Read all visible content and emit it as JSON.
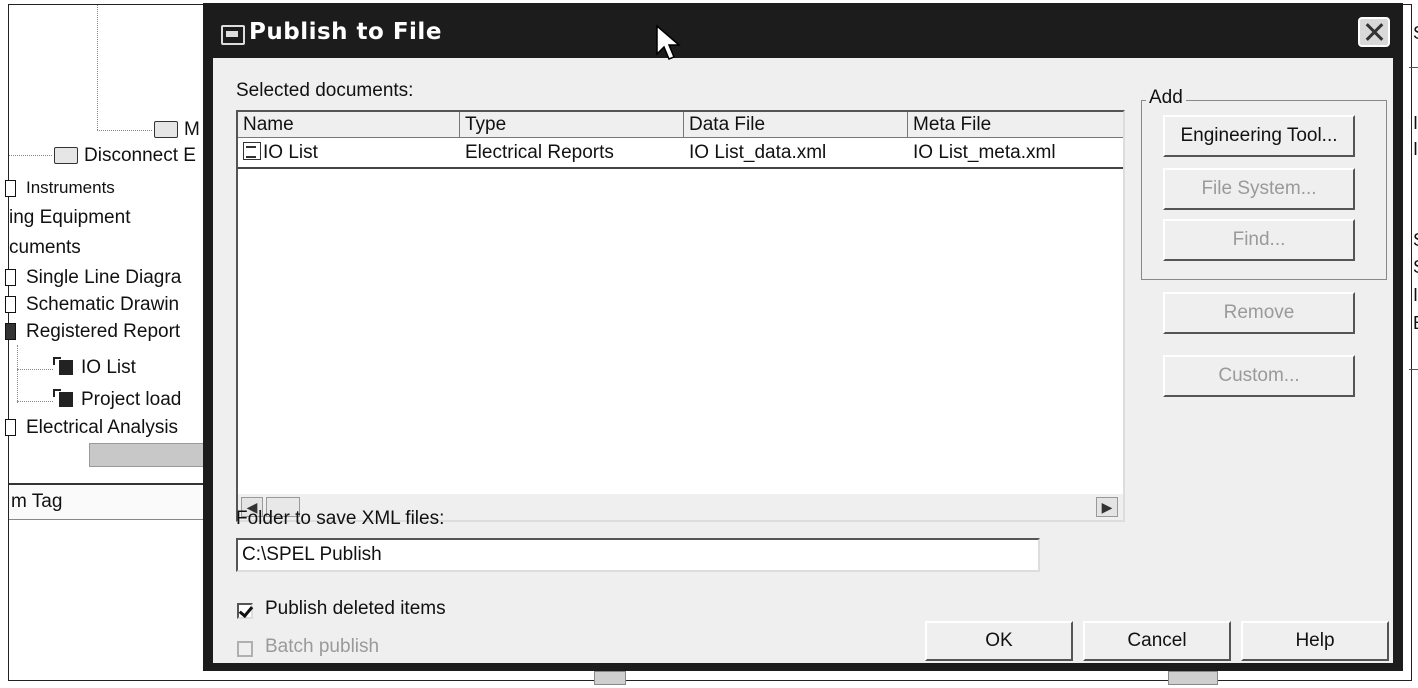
{
  "background": {
    "tree": {
      "items": [
        {
          "label": "Disconnect E"
        },
        {
          "label": "Instruments"
        },
        {
          "label": "ing Equipment"
        },
        {
          "label": "cuments"
        },
        {
          "label": "Single Line Diagra"
        },
        {
          "label": "Schematic Drawin"
        },
        {
          "label": "Registered Report"
        },
        {
          "label": "IO List"
        },
        {
          "label": "Project load"
        },
        {
          "label": "Electrical Analysis"
        }
      ],
      "folder_truncated": "M"
    },
    "column_header": "m Tag",
    "right_pane_fragments": [
      "S",
      "II",
      "II",
      "S",
      "S",
      "II",
      "E"
    ]
  },
  "dialog": {
    "title": "Publish to File",
    "selected_documents_label": "Selected documents:",
    "columns": [
      "Name",
      "Type",
      "Data File",
      "Meta File"
    ],
    "rows": [
      {
        "name": "IO List",
        "type": "Electrical Reports",
        "data_file": "IO List_data.xml",
        "meta_file": "IO List_meta.xml"
      }
    ],
    "add_group_label": "Add",
    "buttons": {
      "engineering_tool": "Engineering Tool...",
      "file_system": "File System...",
      "find": "Find...",
      "remove": "Remove",
      "custom": "Custom..."
    },
    "folder_label": "Folder to save XML files:",
    "folder_value": "C:\\SPEL Publish",
    "publish_deleted_label": "Publish deleted items",
    "publish_deleted_checked": true,
    "batch_publish_label": "Batch publish",
    "batch_publish_checked": false,
    "ok": "OK",
    "cancel": "Cancel",
    "help": "Help"
  }
}
